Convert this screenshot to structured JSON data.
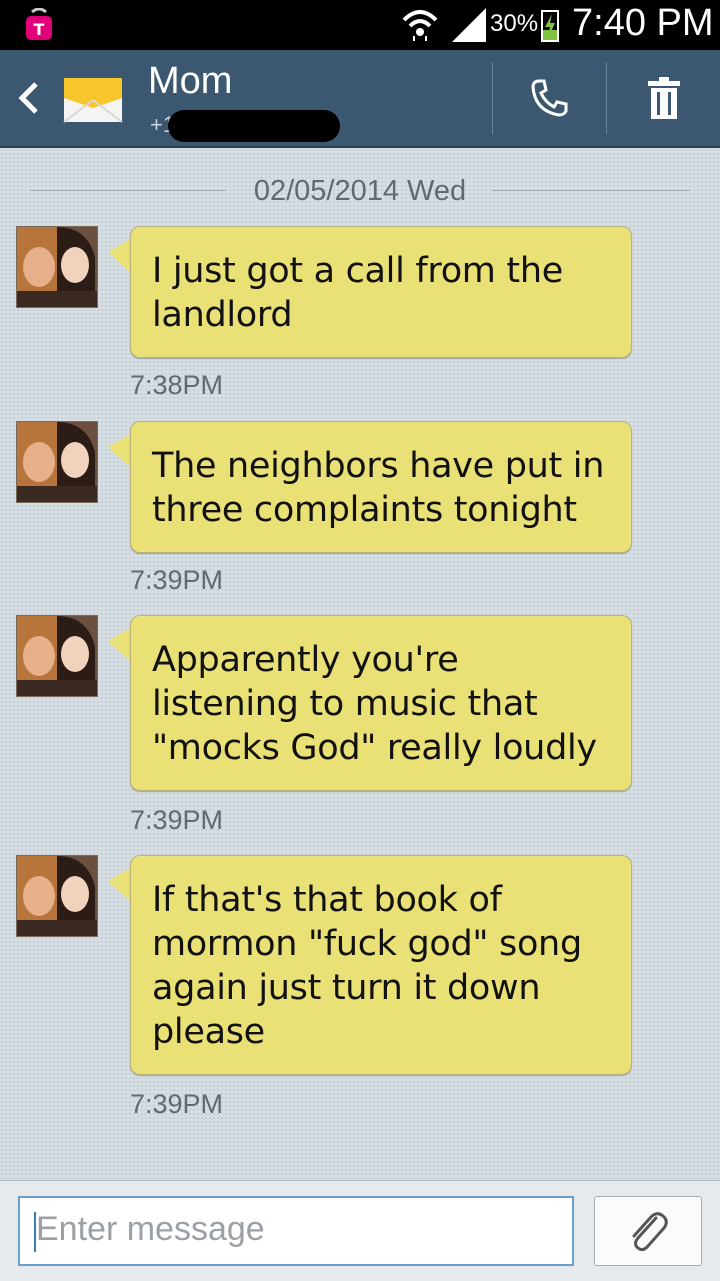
{
  "status_bar": {
    "battery_percent": "30%",
    "time": "7:40 PM",
    "icons": [
      "carrier-icon",
      "wifi-icon",
      "signal-icon",
      "battery-charging-icon"
    ]
  },
  "header": {
    "contact_name": "Mom",
    "contact_number": "+1",
    "icons": [
      "back-icon",
      "envelope-icon",
      "phone-icon",
      "trash-icon"
    ]
  },
  "conversation": {
    "date": "02/05/2014 Wed",
    "messages": [
      {
        "text": "I just got a call from the landlord",
        "time": "7:38PM"
      },
      {
        "text": "The neighbors have put in three complaints tonight",
        "time": "7:39PM"
      },
      {
        "text": "Apparently you're listening to music that \"mocks God\" really loudly",
        "time": "7:39PM"
      },
      {
        "text": "If that's that book of mormon \"fuck god\" song again just turn it down please",
        "time": "7:39PM"
      }
    ]
  },
  "composer": {
    "placeholder": "Enter message",
    "attach_icon": "paperclip-icon"
  },
  "colors": {
    "header": "#3c5870",
    "bubble": "#e9e076",
    "background": "#d6dee4",
    "input_border": "#6aa0cf"
  }
}
